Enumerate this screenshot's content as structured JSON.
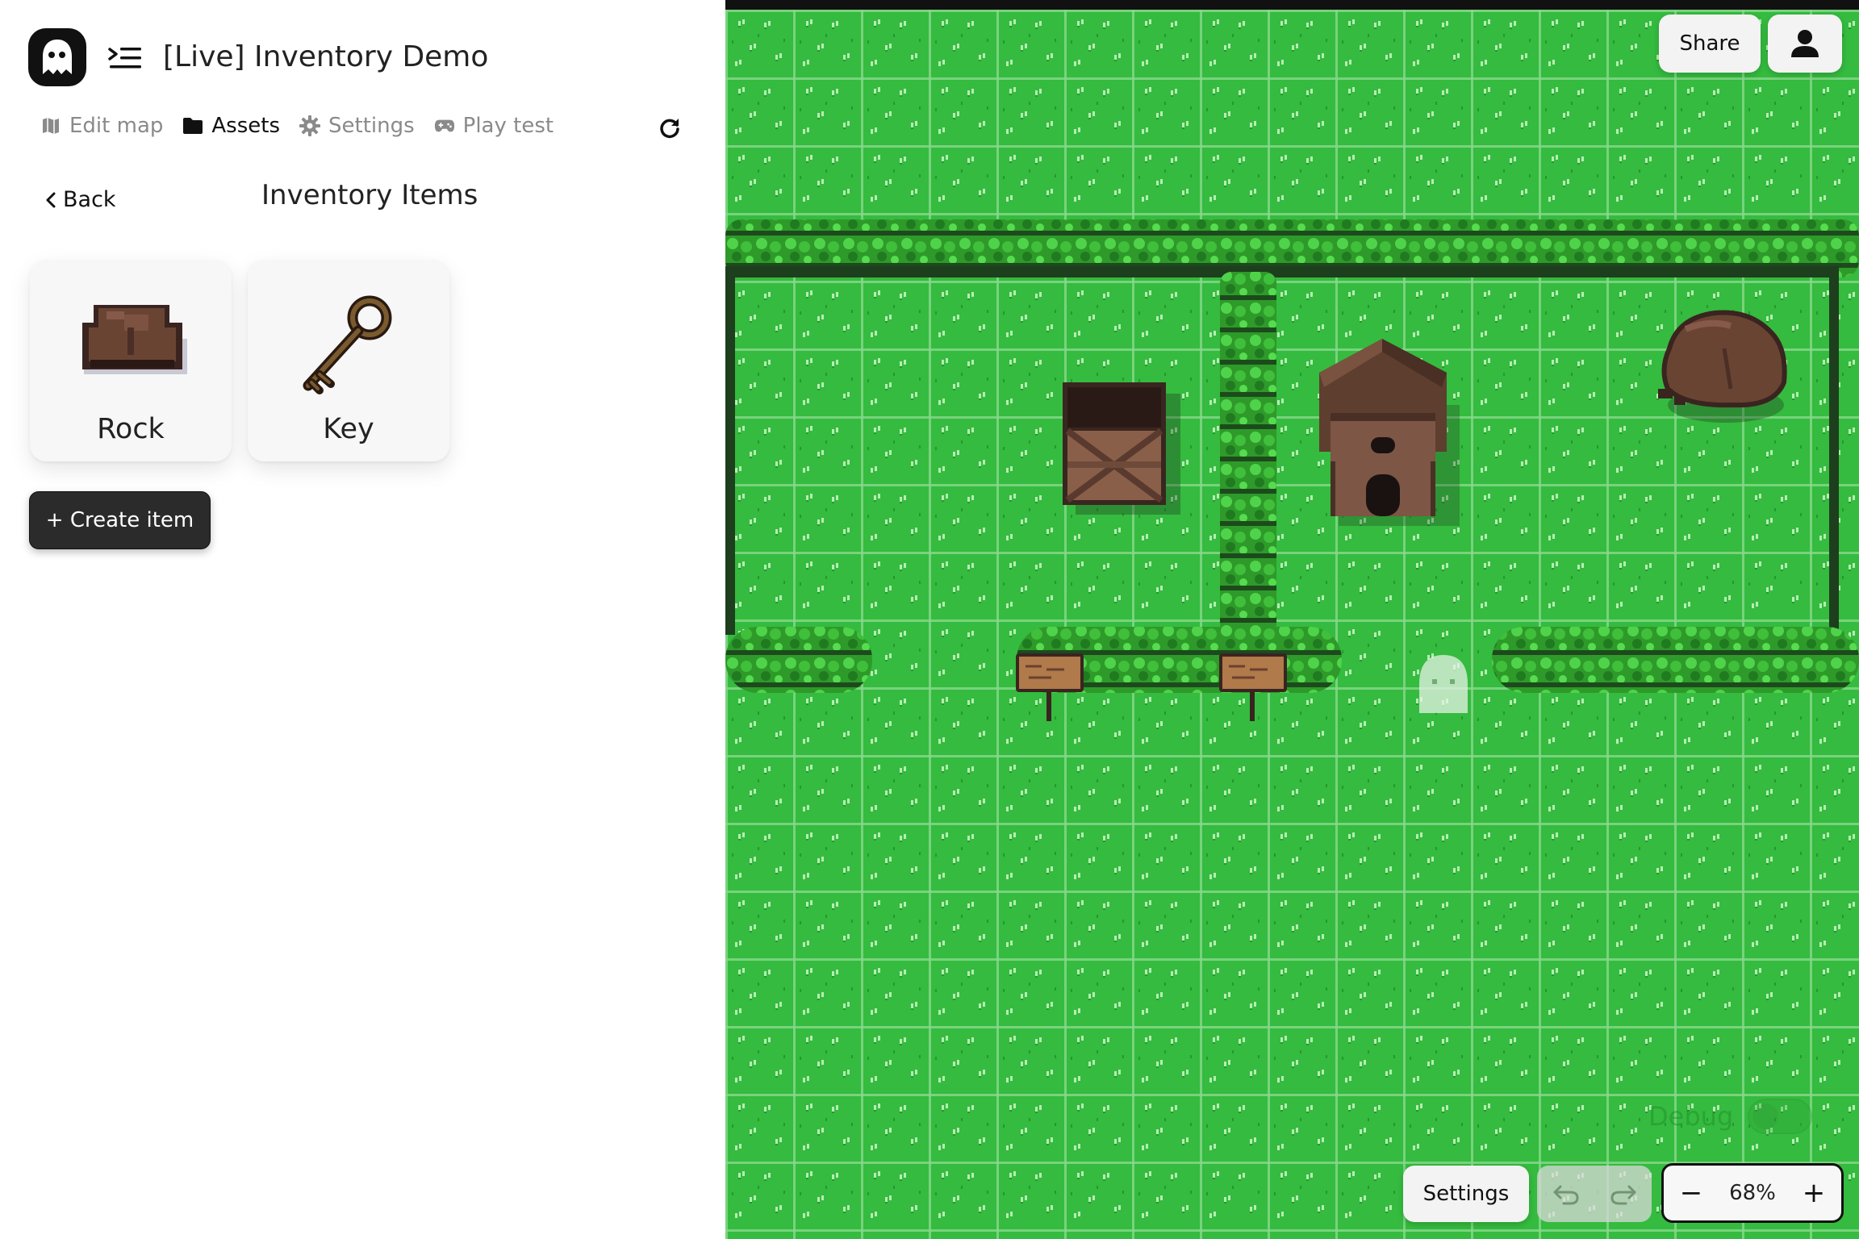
{
  "app": {
    "logo_icon": "ghost-icon",
    "project_title": "[Live] Inventory Demo",
    "menu_icon": "indent-menu-icon"
  },
  "nav": {
    "items": [
      {
        "label": "Edit map",
        "icon": "map-icon",
        "active": false
      },
      {
        "label": "Assets",
        "icon": "folder-icon",
        "active": true
      },
      {
        "label": "Settings",
        "icon": "gear-icon",
        "active": false
      },
      {
        "label": "Play test",
        "icon": "gamepad-icon",
        "active": false
      }
    ],
    "refresh_icon": "refresh-icon"
  },
  "assets": {
    "back_label": "Back",
    "section_title": "Inventory Items",
    "items": [
      {
        "name": "Rock",
        "icon": "rock-sprite"
      },
      {
        "name": "Key",
        "icon": "key-sprite"
      }
    ],
    "create_label": "+ Create item"
  },
  "map": {
    "share_label": "Share",
    "user_icon": "user-icon",
    "settings_label": "Settings",
    "undo_icon": "undo-icon",
    "redo_icon": "redo-icon",
    "zoom_out": "−",
    "zoom_in": "+",
    "zoom_level": "68%",
    "debug_label": "Debug",
    "debug_enabled": false
  },
  "colors": {
    "grass": "#35bb3f",
    "hedge": "#2f8a2a",
    "dark_button": "#2b2b2b",
    "accent_active": "#111111"
  }
}
